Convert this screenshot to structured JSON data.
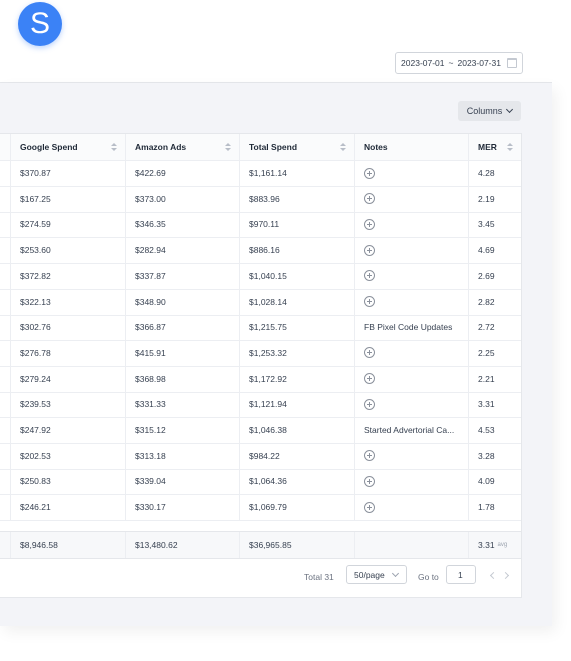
{
  "app": {
    "logo_letter": "S",
    "accent": "#3b82f6"
  },
  "date_range": {
    "start": "2023-07-01",
    "separator": "~",
    "end": "2023-07-31"
  },
  "toolbar": {
    "columns_label": "Columns"
  },
  "table": {
    "columns": [
      "Google Spend",
      "Amazon Ads",
      "Total Spend",
      "Notes",
      "MER"
    ],
    "rows": [
      {
        "google": "$370.87",
        "amazon": "$422.69",
        "total": "$1,161.14",
        "note": "",
        "mer": "4.28"
      },
      {
        "google": "$167.25",
        "amazon": "$373.00",
        "total": "$883.96",
        "note": "",
        "mer": "2.19"
      },
      {
        "google": "$274.59",
        "amazon": "$346.35",
        "total": "$970.11",
        "note": "",
        "mer": "3.45"
      },
      {
        "google": "$253.60",
        "amazon": "$282.94",
        "total": "$886.16",
        "note": "",
        "mer": "4.69"
      },
      {
        "google": "$372.82",
        "amazon": "$337.87",
        "total": "$1,040.15",
        "note": "",
        "mer": "2.69"
      },
      {
        "google": "$322.13",
        "amazon": "$348.90",
        "total": "$1,028.14",
        "note": "",
        "mer": "2.82"
      },
      {
        "google": "$302.76",
        "amazon": "$366.87",
        "total": "$1,215.75",
        "note": "FB Pixel Code Updates",
        "mer": "2.72"
      },
      {
        "google": "$276.78",
        "amazon": "$415.91",
        "total": "$1,253.32",
        "note": "",
        "mer": "2.25"
      },
      {
        "google": "$279.24",
        "amazon": "$368.98",
        "total": "$1,172.92",
        "note": "",
        "mer": "2.21"
      },
      {
        "google": "$239.53",
        "amazon": "$331.33",
        "total": "$1,121.94",
        "note": "",
        "mer": "3.31"
      },
      {
        "google": "$247.92",
        "amazon": "$315.12",
        "total": "$1,046.38",
        "note": "Started Advertorial Ca...",
        "mer": "4.53"
      },
      {
        "google": "$202.53",
        "amazon": "$313.18",
        "total": "$984.22",
        "note": "",
        "mer": "3.28"
      },
      {
        "google": "$250.83",
        "amazon": "$339.04",
        "total": "$1,064.36",
        "note": "",
        "mer": "4.09"
      },
      {
        "google": "$246.21",
        "amazon": "$330.17",
        "total": "$1,069.79",
        "note": "",
        "mer": "1.78"
      }
    ],
    "summary": {
      "google": "$8,946.58",
      "amazon": "$13,480.62",
      "total": "$36,965.85",
      "note": "",
      "mer": "3.31",
      "mer_suffix": "avg"
    }
  },
  "pagination": {
    "total_label": "Total 31",
    "per_page": "50/page",
    "goto_label": "Go to",
    "page": "1"
  }
}
